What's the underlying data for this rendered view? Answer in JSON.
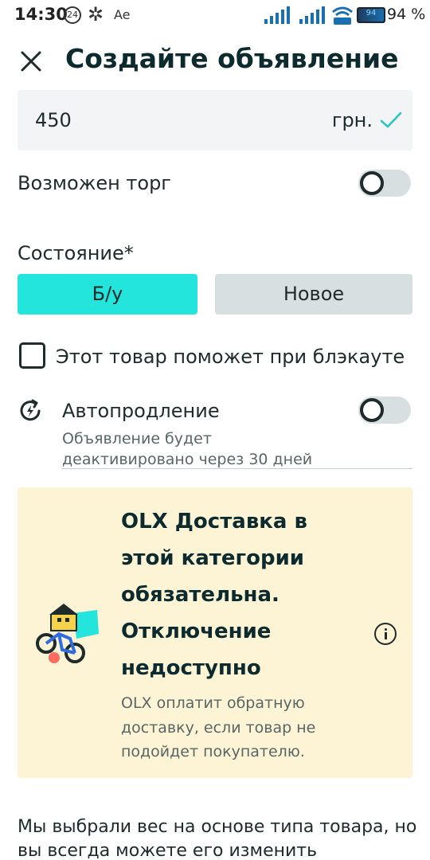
{
  "status_bar": {
    "time": "14:30",
    "badge": "24",
    "asterisk": "✲",
    "carrier": "Ae",
    "battery_text": "94",
    "battery_percent": "94 %",
    "icons": [
      "signal-icon",
      "signal-icon",
      "wifi-icon",
      "battery-icon"
    ]
  },
  "header": {
    "title": "Создайте объявление",
    "close_icon": "close-icon"
  },
  "price": {
    "value": "450",
    "currency": "грн.",
    "valid_icon": "check-icon"
  },
  "negotiable": {
    "label": "Возможен торг",
    "enabled": false
  },
  "condition": {
    "label": "Состояние*",
    "options": [
      "Б/у",
      "Новое"
    ],
    "selected": "Б/у",
    "selected_color": "#23e5db"
  },
  "blackout": {
    "label": "Этот товар поможет при блэкауте",
    "checked": false
  },
  "auto_renew": {
    "label": "Автопродление",
    "description": "Объявление будет деактивировано через 30 дней",
    "enabled": false,
    "icon": "auto-renew-icon"
  },
  "delivery_card": {
    "title": "OLX Доставка в этой категории обязательна. Отключение недоступно",
    "text": "OLX оплатит обратную доставку, если товар не подойдет покупателю.",
    "illustration": "delivery-bike-illustration",
    "info_icon": "info-icon",
    "background": "#fdf3d5"
  },
  "weight_note": "Мы выбрали вес на основе типа товара, но вы всегда можете его изменить"
}
